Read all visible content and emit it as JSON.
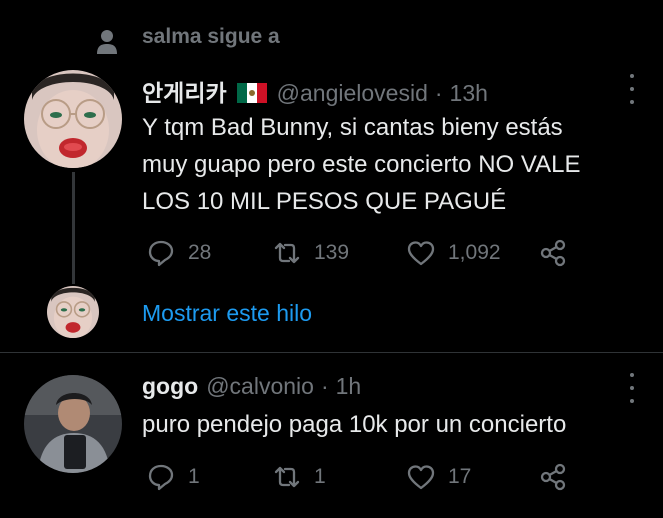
{
  "social_context": {
    "text": "salma sigue a"
  },
  "tweet1": {
    "display_name": "안게리카",
    "handle": "@angielovesid",
    "separator": "·",
    "time": "13h",
    "text": "Y tqm Bad Bunny, si cantas bieny estás\nmuy guapo pero este concierto NO VALE\nLOS 10 MIL PESOS QUE PAGUÉ",
    "replies": "28",
    "retweets": "139",
    "likes": "1,092"
  },
  "show_thread": {
    "label": "Mostrar este hilo"
  },
  "tweet2": {
    "display_name": "gogo",
    "handle": "@calvonio",
    "separator": "·",
    "time": "1h",
    "text": "puro pendejo paga 10k por un concierto",
    "replies": "1",
    "retweets": "1",
    "likes": "17"
  },
  "colors": {
    "background": "#000000",
    "text": "#e7e9ea",
    "muted": "#71767b",
    "link": "#1d9bf0",
    "divider": "#2f3336"
  },
  "icons": [
    "person-icon",
    "flag-mexico-icon",
    "more-icon",
    "reply-icon",
    "retweet-icon",
    "like-icon",
    "share-icon"
  ]
}
